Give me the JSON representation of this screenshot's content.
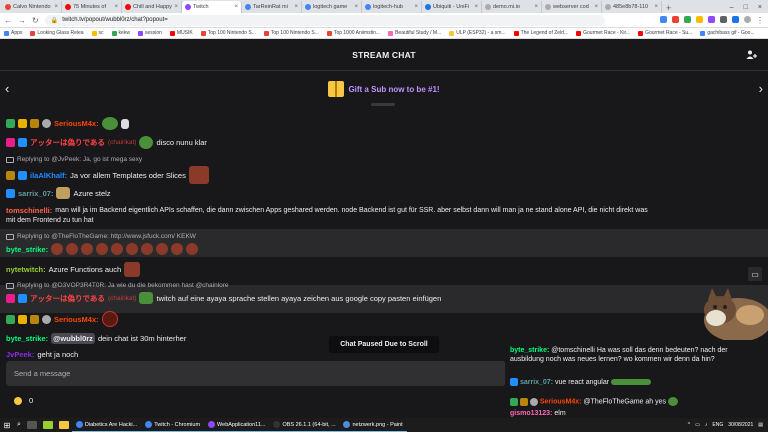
{
  "browser": {
    "tabs": [
      {
        "label": "Calvo Nintendo",
        "color": "#e94335"
      },
      {
        "label": "75 Minutes of",
        "color": "#ff0000"
      },
      {
        "label": "Chill and Happy",
        "color": "#ff0000"
      },
      {
        "label": "Twitch",
        "color": "#9146ff",
        "active": true
      },
      {
        "label": "TarReinRat mi",
        "color": "#4285f4"
      },
      {
        "label": "logitech game",
        "color": "#4285f4"
      },
      {
        "label": "logitech-hub",
        "color": "#4285f4"
      },
      {
        "label": "Ubiquiti - UniFi",
        "color": "#1a73e8"
      },
      {
        "label": "demo.mi.io",
        "color": "#aaa"
      },
      {
        "label": "webserver cod",
        "color": "#aaa"
      },
      {
        "label": "485e8b78-110",
        "color": "#aaa"
      }
    ],
    "url": "twitch.tv/popout/wubbl0rz/chat?popout=",
    "bookmarks": [
      "Apps",
      "Looking Glass Relea",
      "sc",
      "kekw",
      "session",
      "MUSIK",
      "Top 100 Nintendo S...",
      "Top 100 Nintendo S...",
      "Top 1000 Aniimstin...",
      "Beautiful Study / M...",
      "ULP (ESP32) - a sm...",
      "The Legend of Zeld...",
      "Gourmet Race - Kir...",
      "Gourmet Race - Su...",
      "gachibass gif - Goo..."
    ]
  },
  "chat": {
    "title": "STREAM CHAT",
    "gift_text": "Gift a Sub now to be #1!",
    "messages": [
      {
        "user": "SeriousM4x:",
        "color": "#ff4500",
        "text": ""
      },
      {
        "user": "アッターは偽りである",
        "user2": "(chairikat)",
        "color": "#ff4444",
        "text": "disco nunu klar"
      },
      {
        "reply": "Replying to @JvPeek: Ja, go ist mega sexy"
      },
      {
        "user": "ilaAlKhalf:",
        "color": "#1e90ff",
        "text": "Ja vor allem Templates oder Slices"
      },
      {
        "user": "sarrix_07:",
        "color": "#5f9ea0",
        "text": "Azure stelz"
      },
      {
        "user": "tomschinelli:",
        "color": "#ff6347",
        "text": "man will ja im Backend eigentlich APIs schaffen, die dann zwischen Apps geshared werden. node Backend ist gut für SSR. aber selbst dann will man ja ne stand alone API, die nicht direkt was"
      },
      {
        "text": "mit dem Frontend zu tun hat"
      },
      {
        "reply": "Replying to @TheFloTheGame: http://www.jsfuck.com/ KEKW"
      },
      {
        "user": "byte_strike:",
        "color": "#00ff7f",
        "text": ""
      },
      {
        "user": "nytetwitch:",
        "color": "#9acd32",
        "text": "Azure Functions auch"
      },
      {
        "reply": "Replying to @D3VOP3R4T0R: Ja wie du die bekommen hast @chainlore"
      },
      {
        "user": "アッターは偽りである",
        "user2": "(chairikat)",
        "color": "#ff4444",
        "text": "twitch auf eine ayaya sprache stellen ayaya zeichen aus google copy pasten einfügen"
      },
      {
        "user": "SeriousM4x:",
        "color": "#ff4500",
        "text": ""
      },
      {
        "user": "byte_strike:",
        "color": "#00ff7f",
        "mention": "@wubbl0rz",
        "text": "dein chat ist 30m hinterher"
      },
      {
        "user": "JvPeek:",
        "color": "#8a2be2",
        "text": "geht ja noch"
      }
    ],
    "paused_label": "Chat Paused Due to Scroll",
    "input_placeholder": "Send a message",
    "points": "0"
  },
  "overlay": {
    "lines": [
      {
        "user": "byte_strike:",
        "color": "#00ff7f",
        "text": "@tomschinelli Ha was soll das denn bedeuten? nach der ausbildung noch was neues lernen? wo kommen wir denn da hin?"
      },
      {
        "user": "sarrix_07:",
        "color": "#5f9ea0",
        "text": "vue react angular"
      },
      {
        "user": "SeriousM4x:",
        "color": "#ff4500",
        "text": "@TheFloTheGame ah yes"
      },
      {
        "user": "gismo13123:",
        "color": "#ff69b4",
        "text": "elm"
      }
    ]
  },
  "taskbar": {
    "apps": [
      "Diabetics Are Hacki...",
      "Twitch - Chromium",
      "WebApplication11...",
      "OBS 26.1.1 (64-bit, ...",
      "netzwerk.png - Paint"
    ],
    "lang": "ENG",
    "time": "",
    "date": "30/08/2021"
  }
}
